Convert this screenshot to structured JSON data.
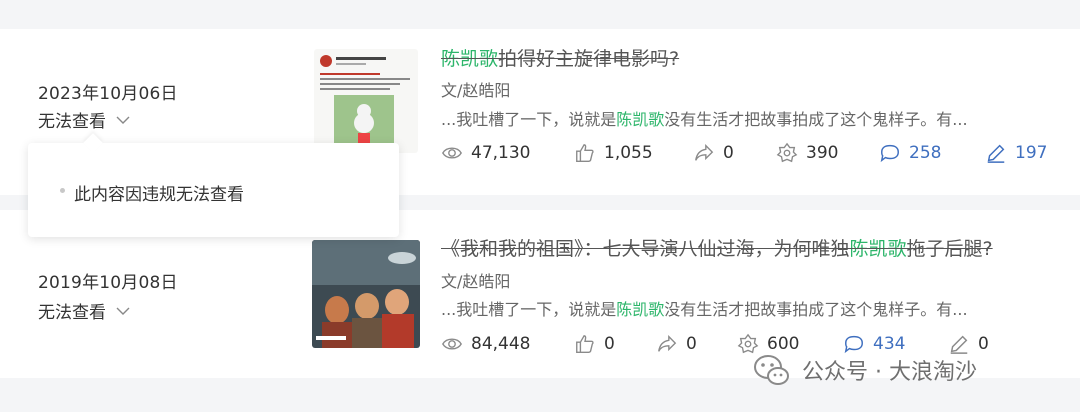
{
  "articles": [
    {
      "date": "2023年10月06日",
      "status": "无法查看",
      "title_highlight": "陈凯歌",
      "title_rest": "拍得好主旋律电影吗?",
      "author": "文/赵皓阳",
      "excerpt_pre": "...我吐槽了一下，说就是",
      "excerpt_highlight": "陈凯歌",
      "excerpt_post": "没有生活才把故事拍成了这个鬼样子。有...",
      "stats": {
        "views": "47,130",
        "likes": "1,055",
        "shares": "0",
        "wow": "390",
        "comments": "258",
        "notes": "197"
      }
    },
    {
      "date": "2019年10月08日",
      "status": "无法查看",
      "title_pre": "《我和我的祖国》：七大导演八仙过海，为何唯独",
      "title_highlight": "陈凯歌",
      "title_post": "拖子后腿?",
      "author": "文/赵皓阳",
      "excerpt_pre": "...我吐槽了一下，说就是",
      "excerpt_highlight": "陈凯歌",
      "excerpt_post": "没有生活才把故事拍成了这个鬼样子。有...",
      "stats": {
        "views": "84,448",
        "likes": "0",
        "shares": "0",
        "wow": "600",
        "comments": "434",
        "notes": "0"
      }
    }
  ],
  "popover": {
    "text": "此内容因违规无法查看"
  },
  "watermark": {
    "text": "公众号 · 大浪淘沙"
  },
  "colors": {
    "highlight": "#2cb56a",
    "comment": "#3f6fbf"
  }
}
